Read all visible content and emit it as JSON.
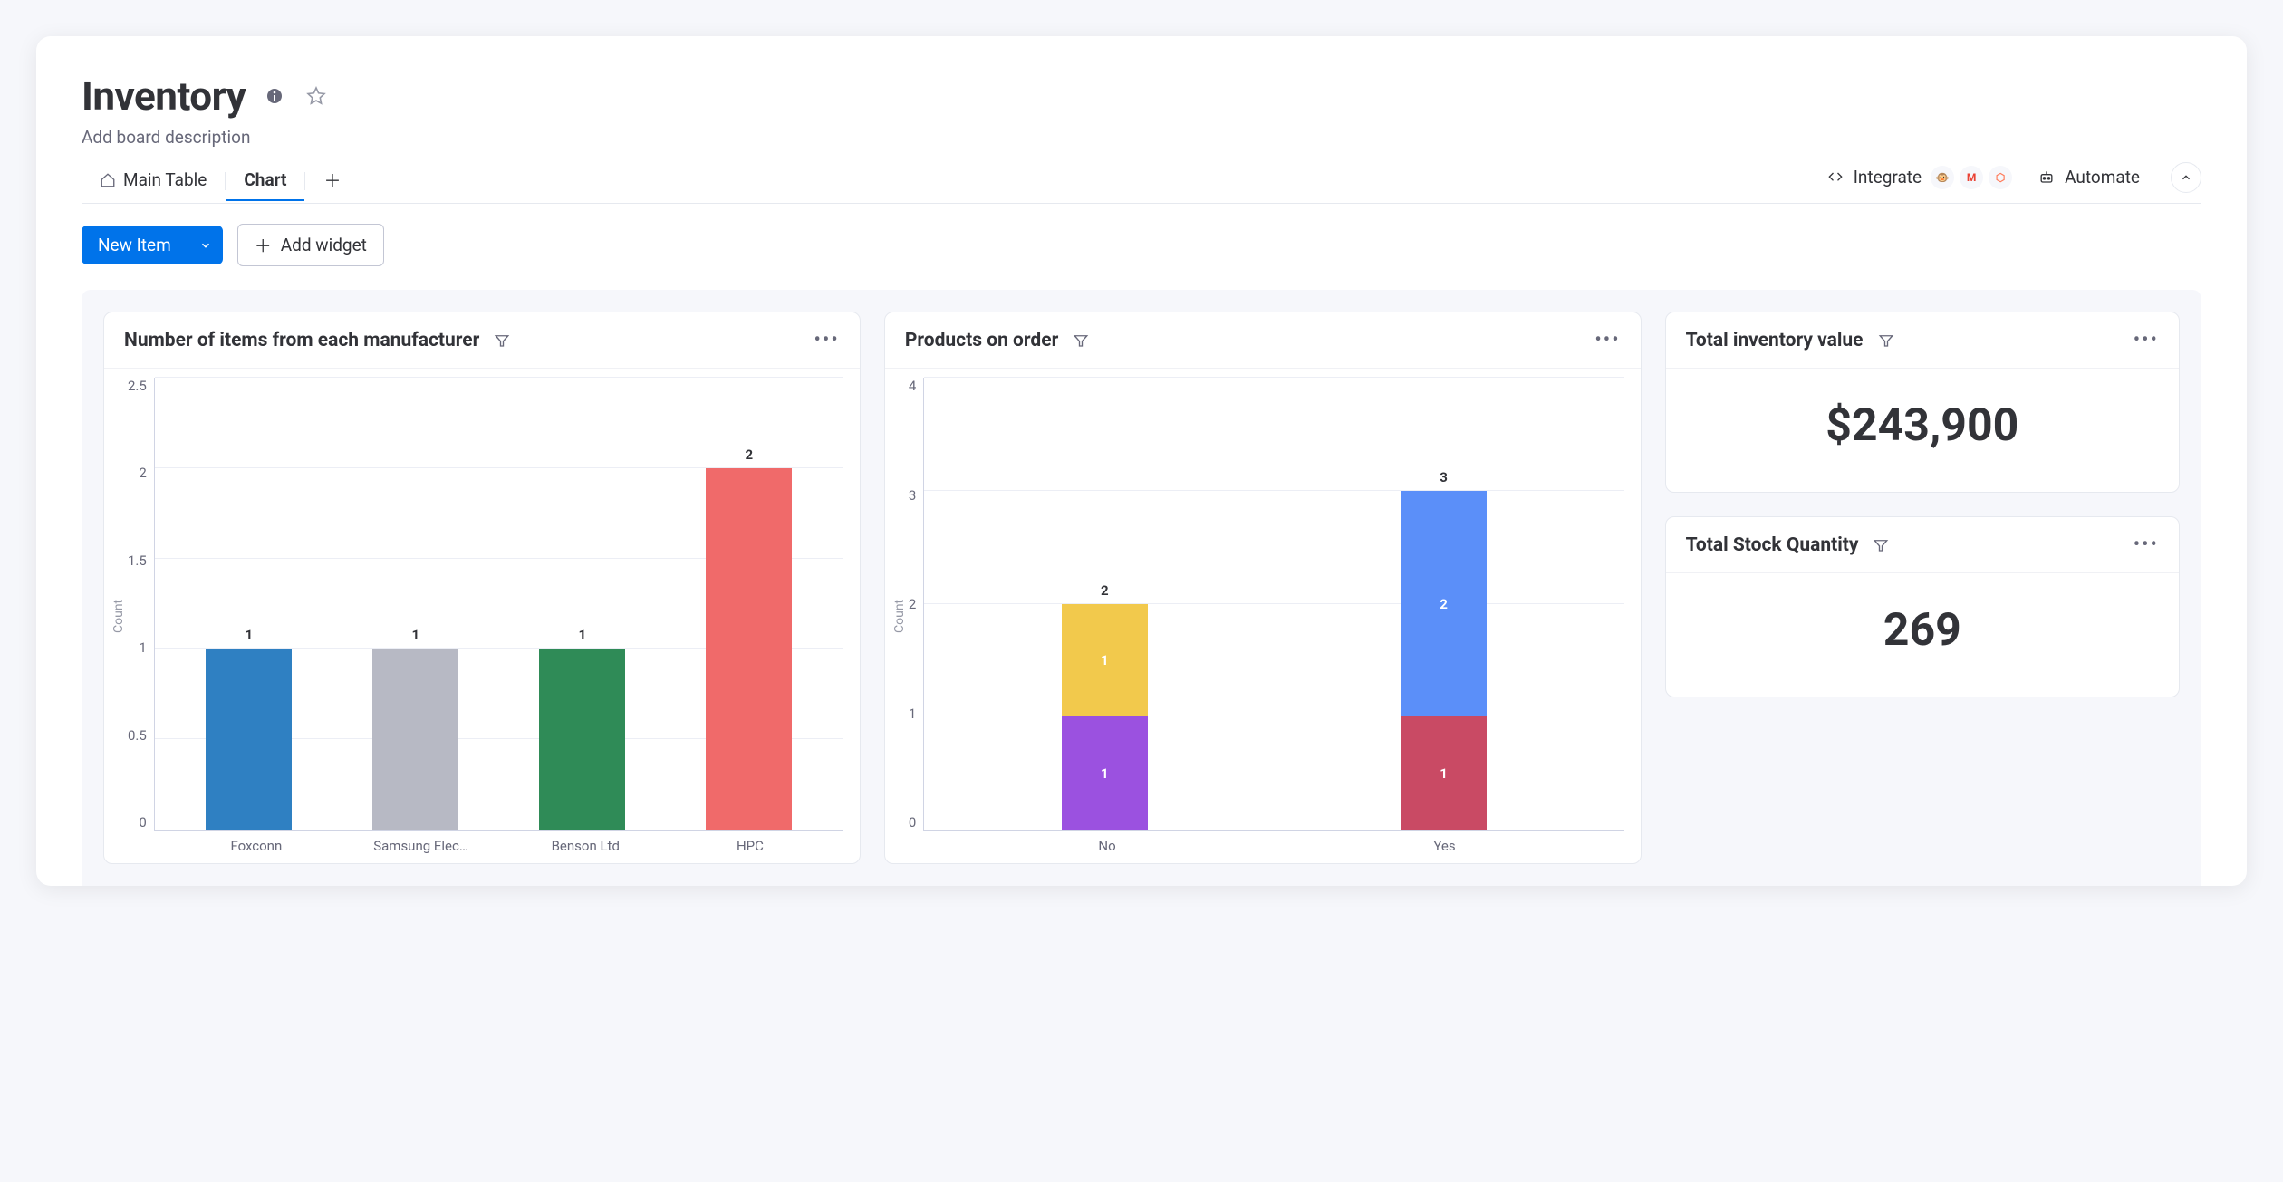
{
  "board": {
    "title": "Inventory",
    "description": "Add board description"
  },
  "tabs": [
    {
      "label": "Main Table",
      "active": false,
      "icon": "home"
    },
    {
      "label": "Chart",
      "active": true,
      "icon": null
    }
  ],
  "toolbar": {
    "integrate_label": "Integrate",
    "automate_label": "Automate",
    "new_item_label": "New Item",
    "add_widget_label": "Add widget"
  },
  "widgets": {
    "manufacturers": {
      "title": "Number of items from each manufacturer"
    },
    "orders": {
      "title": "Products on order"
    },
    "inventory_value": {
      "title": "Total inventory value",
      "value": "$243,900"
    },
    "stock_qty": {
      "title": "Total Stock Quantity",
      "value": "269"
    }
  },
  "chart_data": [
    {
      "id": "manufacturers",
      "type": "bar",
      "title": "Number of items from each manufacturer",
      "ylabel": "Count",
      "xlabel": "",
      "ylim": [
        0,
        2.5
      ],
      "yticks": [
        0,
        0.5,
        1,
        1.5,
        2,
        2.5
      ],
      "categories": [
        "Foxconn",
        "Samsung Elec…",
        "Benson Ltd",
        "HPC"
      ],
      "values": [
        1,
        1,
        1,
        2
      ],
      "colors": [
        "#2f80c2",
        "#b7b9c4",
        "#2f8b57",
        "#f06a6a"
      ]
    },
    {
      "id": "orders",
      "type": "stacked_bar",
      "title": "Products on order",
      "ylabel": "Count",
      "xlabel": "",
      "ylim": [
        0,
        4
      ],
      "yticks": [
        0,
        1,
        2,
        3,
        4
      ],
      "categories": [
        "No",
        "Yes"
      ],
      "series": [
        {
          "name": "seg1",
          "values": [
            1,
            1
          ],
          "colors": [
            "#9b51e0",
            "#c94a64"
          ]
        },
        {
          "name": "seg2",
          "values": [
            1,
            2
          ],
          "colors": [
            "#f2c94c",
            "#5b8ff9"
          ]
        }
      ],
      "totals": [
        2,
        3
      ]
    }
  ]
}
